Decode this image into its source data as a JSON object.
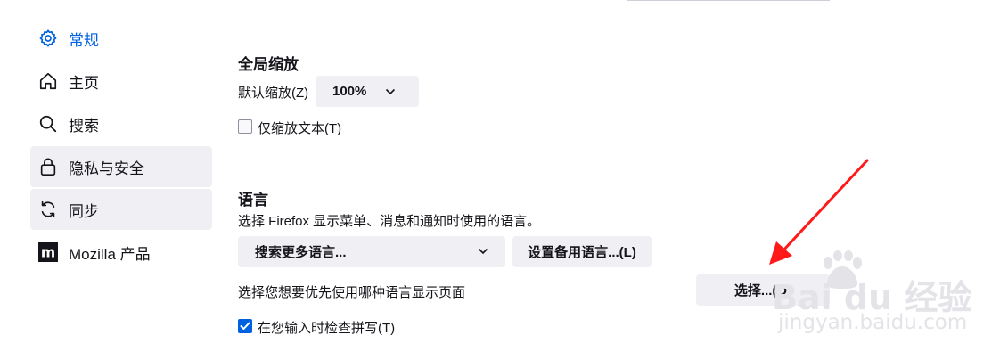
{
  "sidebar": {
    "items": [
      {
        "label": "常规",
        "icon": "gear-icon"
      },
      {
        "label": "主页",
        "icon": "home-icon"
      },
      {
        "label": "搜索",
        "icon": "search-icon"
      },
      {
        "label": "隐私与安全",
        "icon": "lock-icon"
      },
      {
        "label": "同步",
        "icon": "sync-icon"
      },
      {
        "label": "Mozilla 产品",
        "icon": "mozilla-icon"
      }
    ]
  },
  "zoom": {
    "heading": "全局缩放",
    "default_label": "默认缩放(Z)",
    "default_value": "100%",
    "text_only_label": "仅缩放文本(T)",
    "text_only_checked": false
  },
  "language": {
    "heading": "语言",
    "description": "选择 Firefox 显示菜单、消息和通知时使用的语言。",
    "search_more_label": "搜索更多语言...",
    "set_alternatives_label": "设置备用语言...(L)",
    "page_language_label": "选择您想要优先使用哪种语言显示页面",
    "choose_button_label": "选择...(O)",
    "spellcheck_label": "在您输入时检查拼写(T)",
    "spellcheck_checked": true
  },
  "watermark": {
    "brand": "Bai  du 经验",
    "url": "jingyan.baidu.com"
  },
  "colors": {
    "accent": "#0061e0",
    "button_bg": "#f0f0f4",
    "annotation_arrow": "#ff1a1a"
  }
}
